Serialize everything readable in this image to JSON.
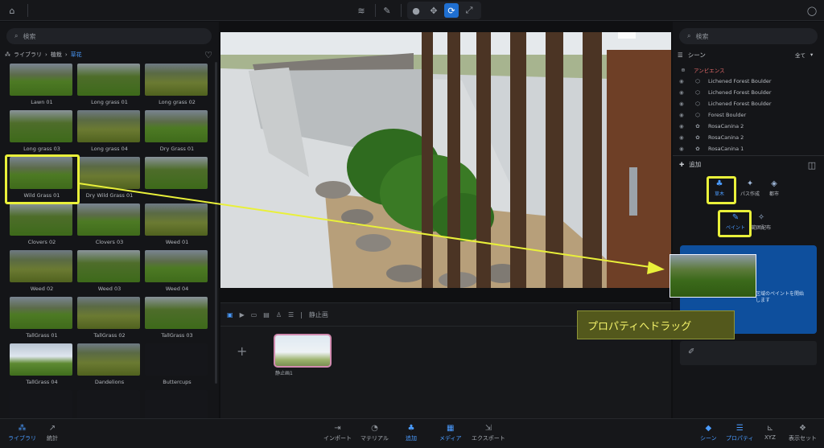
{
  "left_panel": {
    "search_placeholder": "検索",
    "breadcrumb": {
      "root": "ライブラリ",
      "mid": "植栽",
      "current": "草花"
    },
    "assets": [
      {
        "label": "Lawn 01"
      },
      {
        "label": "Long grass 01"
      },
      {
        "label": "Long grass 02"
      },
      {
        "label": "Long grass 03"
      },
      {
        "label": "Long grass 04"
      },
      {
        "label": "Dry Grass 01"
      },
      {
        "label": "Wild Grass 01"
      },
      {
        "label": "Dry Wild Grass 01"
      },
      {
        "label": ""
      },
      {
        "label": "Clovers 02"
      },
      {
        "label": "Clovers 03"
      },
      {
        "label": "Weed 01"
      },
      {
        "label": "Weed 02"
      },
      {
        "label": "Weed 03"
      },
      {
        "label": "Weed 04"
      },
      {
        "label": "TallGrass 01"
      },
      {
        "label": "TallGrass 02"
      },
      {
        "label": "TallGrass 03"
      },
      {
        "label": "TallGrass 04"
      },
      {
        "label": "Dandelions"
      },
      {
        "label": "Buttercups"
      }
    ]
  },
  "timeline": {
    "still_label": "静止画",
    "scene_card_label": "静止画1"
  },
  "right_panel": {
    "search_placeholder": "検索",
    "scene_title": "シーン",
    "filter_label": "全て",
    "ambience_label": "アンビエンス",
    "outline_items": [
      "Lichened Forest Boulder",
      "Lichened Forest Boulder",
      "Lichened Forest Boulder",
      "Forest Boulder",
      "RosaCanina 2",
      "RosaCanina 2",
      "RosaCanina 1"
    ],
    "add_title": "追加",
    "add_buttons": {
      "plant": "草木",
      "path": "パス作成",
      "city": "都市"
    },
    "paint_buttons": {
      "paint": "ペイント",
      "scatter": "範囲配布"
    },
    "drop_hint": "区域のペイントを開始\nします"
  },
  "overlay": {
    "drag_caption": "プロパティへドラッグ",
    "highlight_color": "#e9f03a"
  },
  "bottom_bar": {
    "left": [
      {
        "label": "ライブラリ",
        "active": true
      },
      {
        "label": "統計",
        "active": false
      }
    ],
    "center": [
      {
        "label": "インポート",
        "active": false
      },
      {
        "label": "マテリアル",
        "active": false
      },
      {
        "label": "追加",
        "active": true
      },
      {
        "label": "メディア",
        "active": true
      },
      {
        "label": "エクスポート",
        "active": false
      }
    ],
    "right": [
      {
        "label": "シーン",
        "active": true
      },
      {
        "label": "プロパティ",
        "active": true
      },
      {
        "label": "XYZ",
        "active": false
      },
      {
        "label": "表示セット",
        "active": false
      }
    ]
  },
  "colors": {
    "accent": "#4a9bff",
    "ambience": "#e46a6a",
    "drop_card": "#0e4f9d"
  }
}
